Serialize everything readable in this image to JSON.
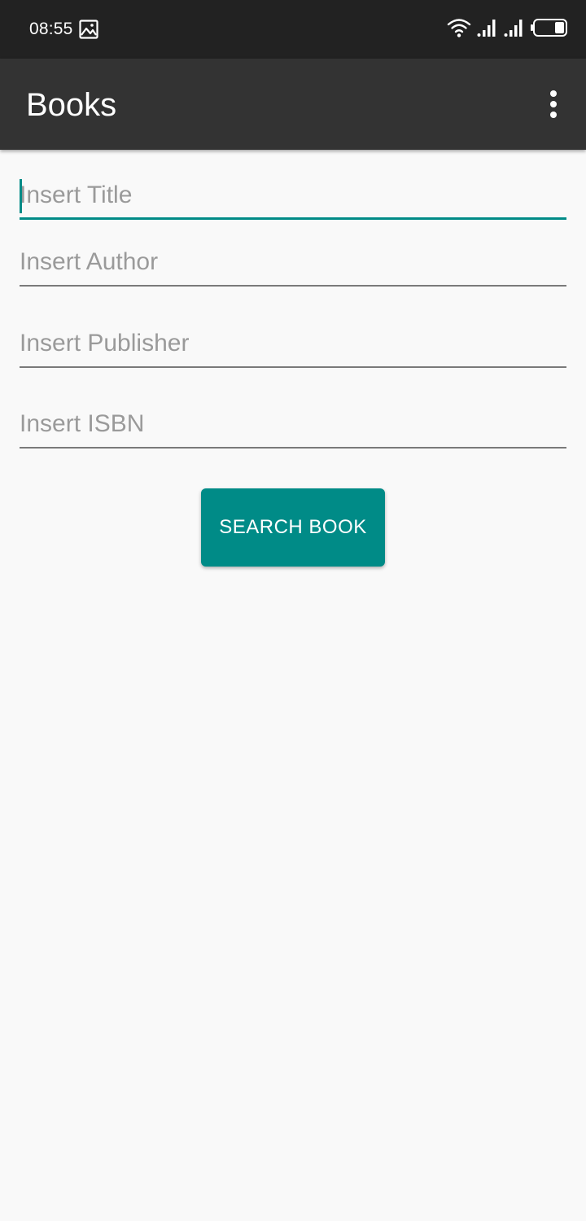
{
  "status_bar": {
    "time": "08:55",
    "left_icons": [
      "image-icon"
    ],
    "right_icons": [
      "wifi-icon",
      "signal-icon",
      "signal-icon",
      "battery-icon"
    ]
  },
  "app_bar": {
    "title": "Books",
    "menu_icon": "more-vert-icon"
  },
  "form": {
    "title": {
      "value": "",
      "placeholder": "Insert Title",
      "focused": true
    },
    "author": {
      "value": "",
      "placeholder": "Insert Author"
    },
    "publisher": {
      "value": "",
      "placeholder": "Insert Publisher"
    },
    "isbn": {
      "value": "",
      "placeholder": "Insert ISBN"
    },
    "search_label": "SEARCH BOOK"
  },
  "colors": {
    "status_bar": "#222222",
    "app_bar": "#333333",
    "accent": "#008b87",
    "background": "#f9f9f9",
    "placeholder": "#9a9a9a"
  }
}
